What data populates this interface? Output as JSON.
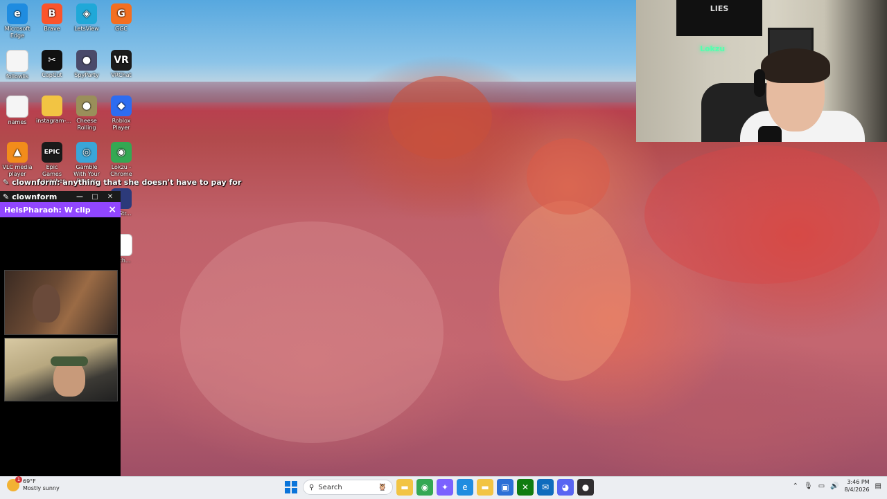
{
  "desktop_icons": [
    {
      "label": "Microsoft Edge",
      "icon": "edge-icon",
      "color": "#1f8ce0",
      "glyph": "e"
    },
    {
      "label": "Brave",
      "icon": "brave-icon",
      "color": "#fb542b",
      "glyph": "B"
    },
    {
      "label": "LetsView",
      "icon": "letsview-icon",
      "color": "#20a8d8",
      "glyph": "◈"
    },
    {
      "label": "GGC",
      "icon": "ggc-icon",
      "color": "#f36f21",
      "glyph": "G"
    },
    {
      "label": "followlis",
      "icon": "text-file-icon",
      "color": "#f5f5f5",
      "glyph": ""
    },
    {
      "label": "CapCut",
      "icon": "capcut-icon",
      "color": "#111111",
      "glyph": "✂"
    },
    {
      "label": "SpyParty",
      "icon": "spyparty-icon",
      "color": "#4a4a6a",
      "glyph": "●"
    },
    {
      "label": "VRChat",
      "icon": "vrchat-icon",
      "color": "#1b1b1b",
      "glyph": "VR"
    },
    {
      "label": "names",
      "icon": "text-file-icon",
      "color": "#f5f5f5",
      "glyph": ""
    },
    {
      "label": "instagram-...",
      "icon": "folder-icon",
      "color": "#f2c443",
      "glyph": ""
    },
    {
      "label": "Cheese Rolling",
      "icon": "cheese-rolling-icon",
      "color": "#9a8f5a",
      "glyph": "●"
    },
    {
      "label": "Roblox Player",
      "icon": "roblox-icon",
      "color": "#2d6cf0",
      "glyph": "◆"
    },
    {
      "label": "VLC media player",
      "icon": "vlc-icon",
      "color": "#f28c1b",
      "glyph": "▲"
    },
    {
      "label": "Epic Games Launcher",
      "icon": "epic-games-icon",
      "color": "#1a1a1a",
      "glyph": "EPIC"
    },
    {
      "label": "Gamble With Your Friends",
      "icon": "gamble-icon",
      "color": "#3aa6d8",
      "glyph": "◎"
    },
    {
      "label": "Lokzu - Chrome",
      "icon": "chrome-icon",
      "color": "#34a853",
      "glyph": "◉"
    },
    {
      "label": "er-Str...",
      "icon": "app-icon",
      "color": "#2c3a7a",
      "glyph": ""
    },
    {
      "label": "ench...",
      "icon": "clock-app-icon",
      "color": "#ffffff",
      "glyph": ""
    }
  ],
  "chat_overlay": {
    "username": "clownform",
    "message": "anything that she doesn't have to pay for"
  },
  "chat_window": {
    "title": "clownform",
    "header_text": "HelsPharaoh: W clip",
    "close_symbol": "×",
    "window_buttons": [
      "—",
      "□",
      "✕"
    ]
  },
  "webcam": {
    "poster_text": "LIES",
    "neon_text": "Lokzu"
  },
  "taskbar": {
    "weather_temp": "69°F",
    "weather_desc": "Mostly sunny",
    "weather_badge": "1",
    "search_placeholder": "Search",
    "apps": [
      {
        "name": "file-explorer-icon",
        "color": "#f2c443",
        "glyph": "▬"
      },
      {
        "name": "chrome-icon",
        "color": "#34a853",
        "glyph": "◉"
      },
      {
        "name": "copilot-icon",
        "color": "#7b61ff",
        "glyph": "✦"
      },
      {
        "name": "edge-icon",
        "color": "#1f8ce0",
        "glyph": "e"
      },
      {
        "name": "folder-icon",
        "color": "#f2c443",
        "glyph": "▬"
      },
      {
        "name": "store-icon",
        "color": "#2b6fd6",
        "glyph": "▣"
      },
      {
        "name": "xbox-icon",
        "color": "#107c10",
        "glyph": "✕"
      },
      {
        "name": "outlook-icon",
        "color": "#0f6cbd",
        "glyph": "✉"
      },
      {
        "name": "discord-icon",
        "color": "#5865f2",
        "glyph": "◕"
      },
      {
        "name": "obs-icon",
        "color": "#302e31",
        "glyph": "●"
      }
    ],
    "time": "3:46 PM",
    "date": "8/4/2026"
  }
}
